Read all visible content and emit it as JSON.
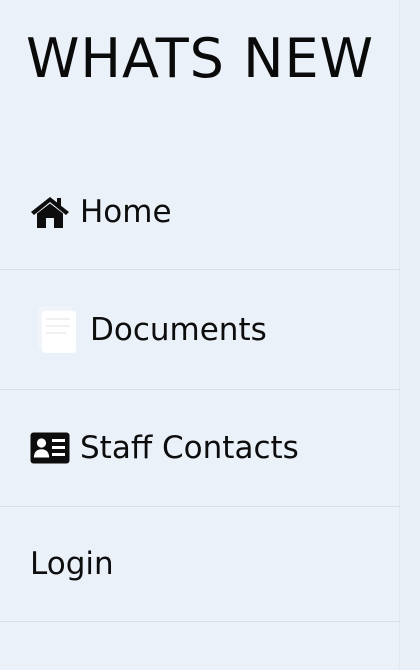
{
  "brand": {
    "title": "WHATS NEW"
  },
  "menu": {
    "items": [
      {
        "label": "Home",
        "icon": "home-icon"
      },
      {
        "label": "Documents",
        "icon": "documents-icon"
      },
      {
        "label": "Staff Contacts",
        "icon": "id-card-icon"
      },
      {
        "label": "Login"
      }
    ]
  },
  "colors": {
    "background": "#ebf1f9",
    "text": "#0d0d0d",
    "divider": "#d9dfe6"
  }
}
